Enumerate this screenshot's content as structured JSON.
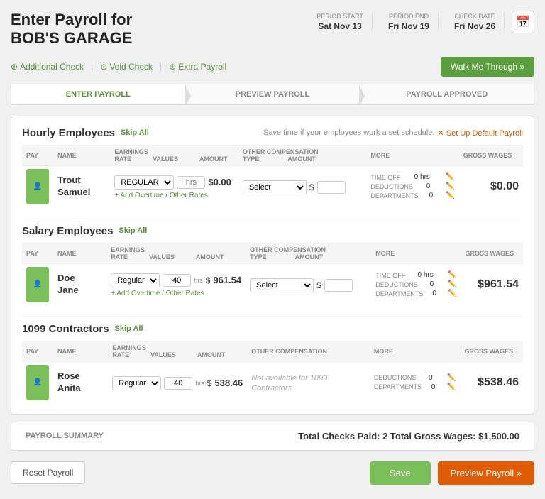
{
  "header": {
    "title_line1": "Enter Payroll for",
    "title_line2": "BOB'S GARAGE",
    "period_start_label": "PERIOD START",
    "period_start_value": "Sat Nov 13",
    "period_end_label": "PERIOD END",
    "period_end_value": "Fri Nov 19",
    "check_date_label": "CHECK DATE",
    "check_date_value": "Fri Nov 26"
  },
  "actions": {
    "additional_check": "Additional Check",
    "void_check": "Void Check",
    "extra_payroll": "Extra Payroll",
    "walk_me_through": "Walk Me Through »"
  },
  "steps": [
    {
      "label": "ENTER PAYROLL",
      "active": true
    },
    {
      "label": "PREVIEW PAYROLL",
      "active": false
    },
    {
      "label": "PAYROLL APPROVED",
      "active": false
    }
  ],
  "sections": {
    "hourly": {
      "title": "Hourly Employees",
      "skip_all": "Skip All",
      "schedule_note": "Save time if your employees work a set schedule.",
      "setup_link": "✕ Set Up Default Payroll",
      "columns": {
        "pay": "PAY",
        "name": "NAME",
        "earnings": "EARNINGS",
        "other": "OTHER COMPENSATION",
        "more": "MORE",
        "gross": "GROSS WAGES"
      },
      "sub_columns": {
        "rate": "RATE",
        "values": "VALUES",
        "amount": "AMOUNT",
        "type": "TYPE",
        "type_amount": "AMOUNT"
      },
      "employees": [
        {
          "name_line1": "Trout",
          "name_line2": "Samuel",
          "rate": "REGULAR",
          "values": "hrs",
          "amount": "$0.00",
          "type": "Select",
          "other_amount": "$",
          "time_off_label": "TIME OFF",
          "time_off_value": "0 hrs",
          "deductions_label": "DEDUCTIONS",
          "deductions_value": "0",
          "departments_label": "DEPARTMENTS",
          "departments_value": "0",
          "gross": "$0.00",
          "add_overtime": "+ Add Overtime / Other Rates"
        }
      ]
    },
    "salary": {
      "title": "Salary Employees",
      "skip_all": "Skip All",
      "columns": {
        "pay": "PAY",
        "name": "NAME",
        "earnings": "EARNINGS",
        "other": "OTHER COMPENSATION",
        "more": "MORE",
        "gross": "GROSS WAGES"
      },
      "sub_columns": {
        "rate": "RATE",
        "values": "VALUES",
        "amount": "AMOUNT",
        "type": "TYPE",
        "type_amount": "AMOUNT"
      },
      "employees": [
        {
          "name_line1": "Doe",
          "name_line2": "Jane",
          "rate": "Regular",
          "values": "40",
          "values_unit": "hrs",
          "amount": "961.54",
          "type": "Select",
          "other_amount": "$",
          "time_off_label": "TIME OFF",
          "time_off_value": "0 hrs",
          "deductions_label": "DEDUCTIONS",
          "deductions_value": "0",
          "departments_label": "DEPARTMENTS",
          "departments_value": "0",
          "gross": "$961.54",
          "add_overtime": "+ Add Overtime / Other Rates"
        }
      ]
    },
    "contractors": {
      "title": "1099 Contractors",
      "skip_all": "Skip All",
      "columns": {
        "pay": "PAY",
        "name": "NAME",
        "earnings": "EARNINGS",
        "other": "OTHER COMPENSATION",
        "more": "MORE",
        "gross": "GROSS WAGES"
      },
      "sub_columns": {
        "rate": "RATE",
        "values": "VALUES",
        "amount": "AMOUNT"
      },
      "employees": [
        {
          "name_line1": "Rose",
          "name_line2": "Anita",
          "rate": "Regular",
          "values": "40",
          "values_unit": "hrs",
          "amount": "538.46",
          "not_available": "Not available for 1099 Contractors",
          "deductions_label": "DEDUCTIONS",
          "deductions_value": "0",
          "departments_label": "DEPARTMENTS",
          "departments_value": "0",
          "gross": "$538.46"
        }
      ]
    }
  },
  "summary": {
    "label": "PAYROLL SUMMARY",
    "totals": "Total Checks Paid: 2   Total Gross Wages: $1,500.00"
  },
  "footer": {
    "reset": "Reset Payroll",
    "save": "Save",
    "preview": "Preview Payroll »"
  }
}
